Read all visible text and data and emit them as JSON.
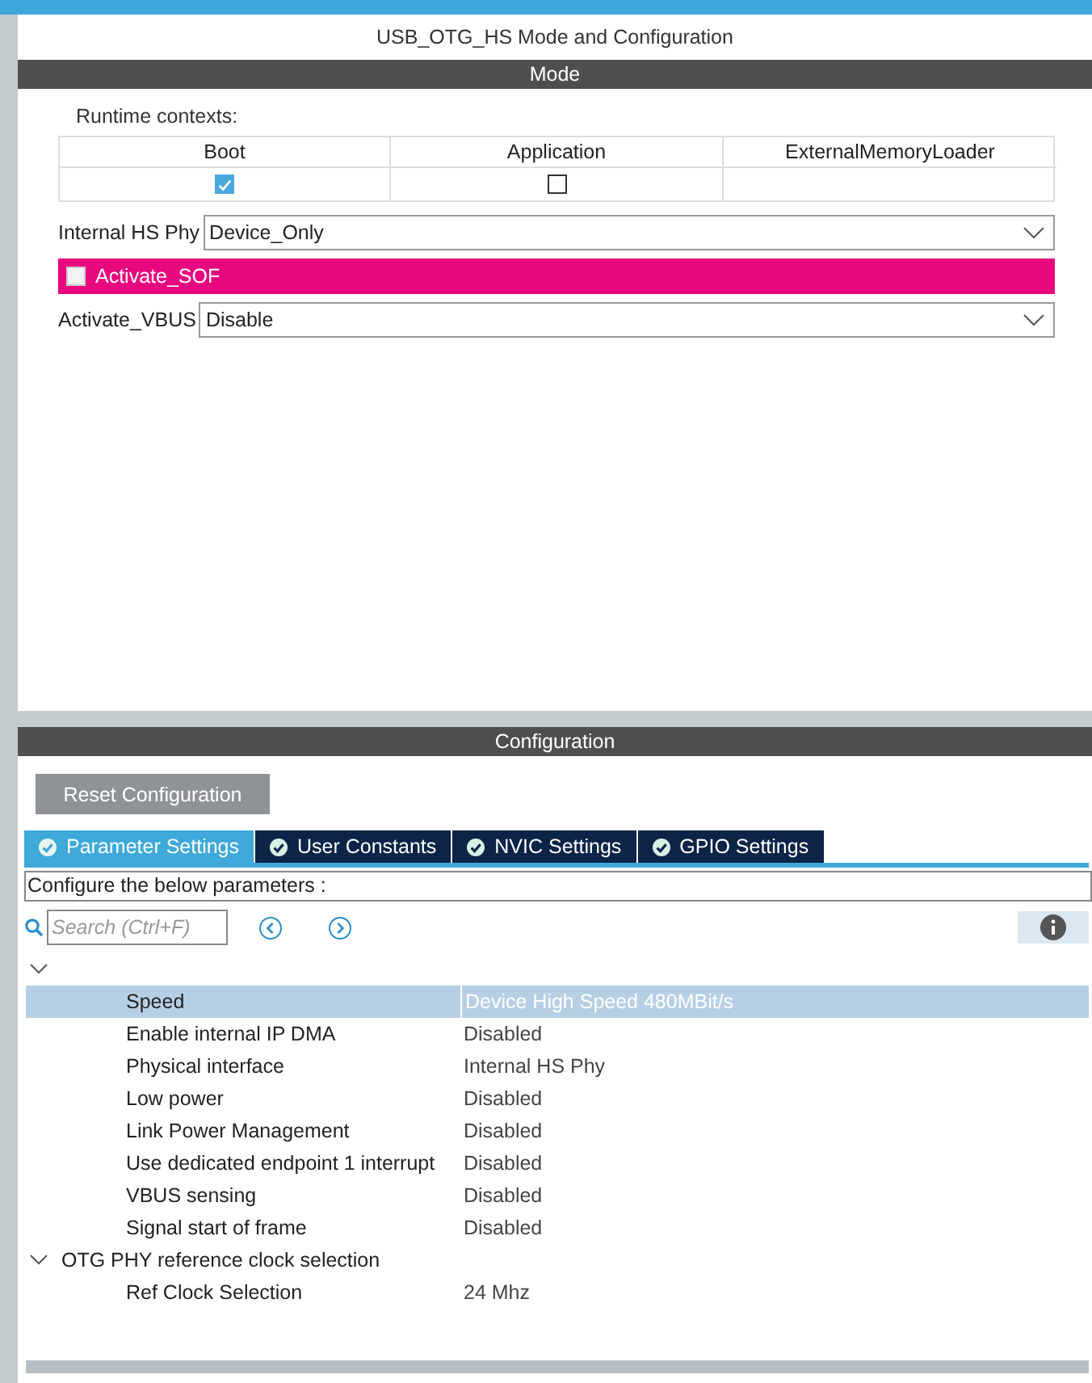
{
  "panel_title": "USB_OTG_HS Mode and Configuration",
  "mode": {
    "header": "Mode",
    "runtime_label": "Runtime contexts:",
    "contexts": [
      {
        "label": "Boot",
        "kind": "checkbox",
        "checked": true
      },
      {
        "label": "Application",
        "kind": "checkbox",
        "checked": false
      },
      {
        "label": "ExternalMemoryLoader",
        "kind": "none"
      }
    ],
    "settings": [
      {
        "kind": "select",
        "label": "Internal HS Phy",
        "value": "Device_Only"
      },
      {
        "kind": "checkbox",
        "label": "Activate_SOF",
        "checked": false,
        "highlighted": true
      },
      {
        "kind": "select",
        "label": "Activate_VBUS",
        "value": "Disable"
      }
    ]
  },
  "configuration": {
    "header": "Configuration",
    "reset_button": "Reset Configuration",
    "tabs": [
      {
        "label": "Parameter Settings",
        "selected": true
      },
      {
        "label": "User Constants",
        "selected": false
      },
      {
        "label": "NVIC Settings",
        "selected": false
      },
      {
        "label": "GPIO Settings",
        "selected": false
      }
    ],
    "description": "Configure the below parameters :",
    "search": {
      "placeholder": "Search (Ctrl+F)"
    },
    "tree": [
      {
        "expanded": true,
        "children": [
          {
            "name": "Speed",
            "value": "Device High Speed 480MBit/s",
            "selected": true
          },
          {
            "name": "Enable internal IP DMA",
            "value": "Disabled",
            "selected": false
          },
          {
            "name": "Physical interface",
            "value": "Internal HS Phy",
            "selected": false
          },
          {
            "name": "Low power",
            "value": "Disabled",
            "selected": false
          },
          {
            "name": "Link Power Management",
            "value": "Disabled",
            "selected": false
          },
          {
            "name": "Use dedicated endpoint 1 interrupt",
            "value": "Disabled",
            "selected": false
          },
          {
            "name": "VBUS sensing",
            "value": "Disabled",
            "selected": false
          },
          {
            "name": "Signal start of frame",
            "value": "Disabled",
            "selected": false
          }
        ]
      },
      {
        "label": "OTG PHY reference clock selection",
        "expanded": true,
        "children": [
          {
            "name": "Ref Clock Selection",
            "value": "24 Mhz",
            "selected": false
          }
        ]
      }
    ]
  }
}
